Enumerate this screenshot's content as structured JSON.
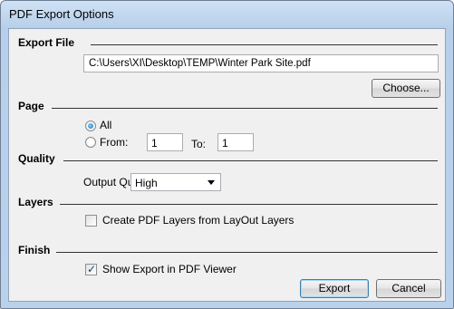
{
  "window": {
    "title": "PDF Export Options"
  },
  "export_file": {
    "title": "Export File",
    "path_value": "C:\\Users\\XI\\Desktop\\TEMP\\Winter Park Site.pdf",
    "choose_label": "Choose..."
  },
  "page": {
    "title": "Page",
    "all_label": "All",
    "all_selected": true,
    "from_label": "From:",
    "from_value": "1",
    "to_label": "To:",
    "to_value": "1"
  },
  "quality": {
    "title": "Quality",
    "output_quality_label": "Output Quality",
    "output_quality_value": "High"
  },
  "layers": {
    "title": "Layers",
    "create_layers_label": "Create PDF Layers from LayOut Layers",
    "create_layers_checked": false
  },
  "finish": {
    "title": "Finish",
    "show_in_viewer_label": "Show Export in PDF Viewer",
    "show_in_viewer_checked": true
  },
  "buttons": {
    "export_label": "Export",
    "cancel_label": "Cancel"
  }
}
